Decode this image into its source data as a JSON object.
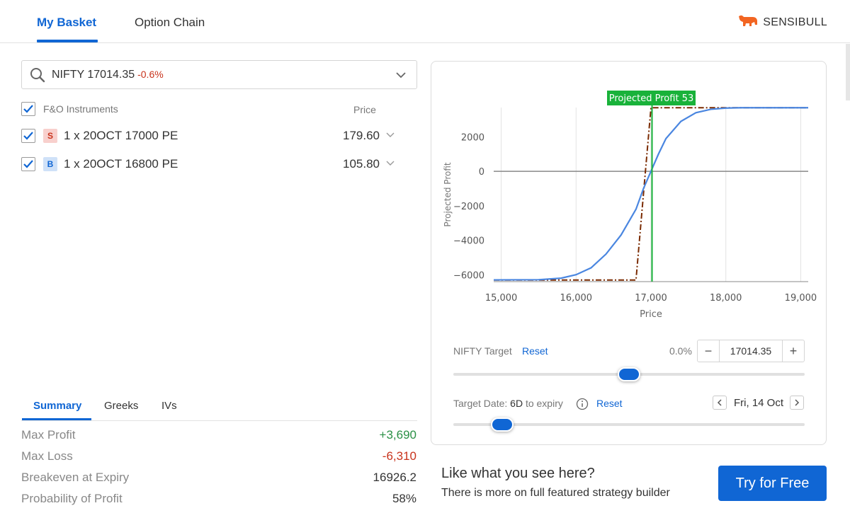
{
  "tabs": [
    {
      "label": "My Basket",
      "active": true
    },
    {
      "label": "Option Chain",
      "active": false
    }
  ],
  "brand": {
    "name": "SENSIBULL",
    "icon": "bull-logo-icon",
    "color": "#f26522"
  },
  "colors": {
    "accent": "#1066d4",
    "profit": "#2a9045",
    "loss": "#c8331c",
    "marker": "#19b23a",
    "expiry_line": "#7a2a00",
    "curve": "#4a86e0"
  },
  "search": {
    "symbol": "NIFTY 17014.35",
    "change": "-0.6%"
  },
  "instruments": {
    "header": "F&O Instruments",
    "price_header": "Price",
    "legs": [
      {
        "tag": "S",
        "desc": "1 x 20OCT 17000 PE",
        "price": "179.60",
        "checked": true
      },
      {
        "tag": "B",
        "desc": "1 x 20OCT 16800 PE",
        "price": "105.80",
        "checked": true
      }
    ]
  },
  "summary_tabs": [
    "Summary",
    "Greeks",
    "IVs"
  ],
  "summary": [
    {
      "label": "Max Profit",
      "value": "+3,690",
      "tone": "pos"
    },
    {
      "label": "Max Loss",
      "value": "-6,310",
      "tone": "neg"
    },
    {
      "label": "Breakeven at Expiry",
      "value": "16926.2",
      "tone": ""
    },
    {
      "label": "Probability of Profit",
      "value": "58%",
      "tone": ""
    }
  ],
  "chart_data": {
    "type": "line",
    "xlabel": "Price",
    "ylabel": "Projected Profit",
    "xlim": [
      14900,
      19100
    ],
    "ylim": [
      -6400,
      3700
    ],
    "x_ticks": [
      15000,
      16000,
      17000,
      18000,
      19000
    ],
    "x_tick_labels": [
      "15,000",
      "16,000",
      "17,000",
      "18,000",
      "19,000"
    ],
    "y_ticks": [
      2000,
      0,
      -2000,
      -4000,
      -6000
    ],
    "y_tick_labels": [
      "2000",
      "0",
      "−2000",
      "−4000",
      "−6000"
    ],
    "grid": true,
    "marker": {
      "x": 17014.35,
      "label": "Projected Profit 53"
    },
    "series": [
      {
        "style": "dash-dot",
        "x": [
          14900,
          16800,
          17000,
          19100
        ],
        "y": [
          -6310,
          -6310,
          3690,
          3690
        ]
      },
      {
        "style": "solid",
        "x": [
          14900,
          15500,
          15800,
          16000,
          16200,
          16400,
          16600,
          16800,
          16900,
          17000,
          17100,
          17200,
          17400,
          17600,
          17800,
          18000,
          18200,
          18500,
          19100
        ],
        "y": [
          -6300,
          -6290,
          -6200,
          -6000,
          -5600,
          -4800,
          -3700,
          -2200,
          -1000,
          0,
          1000,
          1900,
          2900,
          3400,
          3600,
          3670,
          3690,
          3690,
          3690
        ]
      }
    ]
  },
  "controls": {
    "target_label": "NIFTY Target",
    "reset_label": "Reset",
    "target_pct": "0.0%",
    "target_value": "17014.35",
    "target_slider_fraction": 0.5,
    "date_label": "Target Date:",
    "days": "6D",
    "to_expiry": "to expiry",
    "date_reset_label": "Reset",
    "date_value": "Fri, 14 Oct",
    "date_slider_fraction": 0.14
  },
  "promo": {
    "title": "Like what you see here?",
    "subtitle": "There is more on full featured strategy builder",
    "cta": "Try for Free"
  }
}
